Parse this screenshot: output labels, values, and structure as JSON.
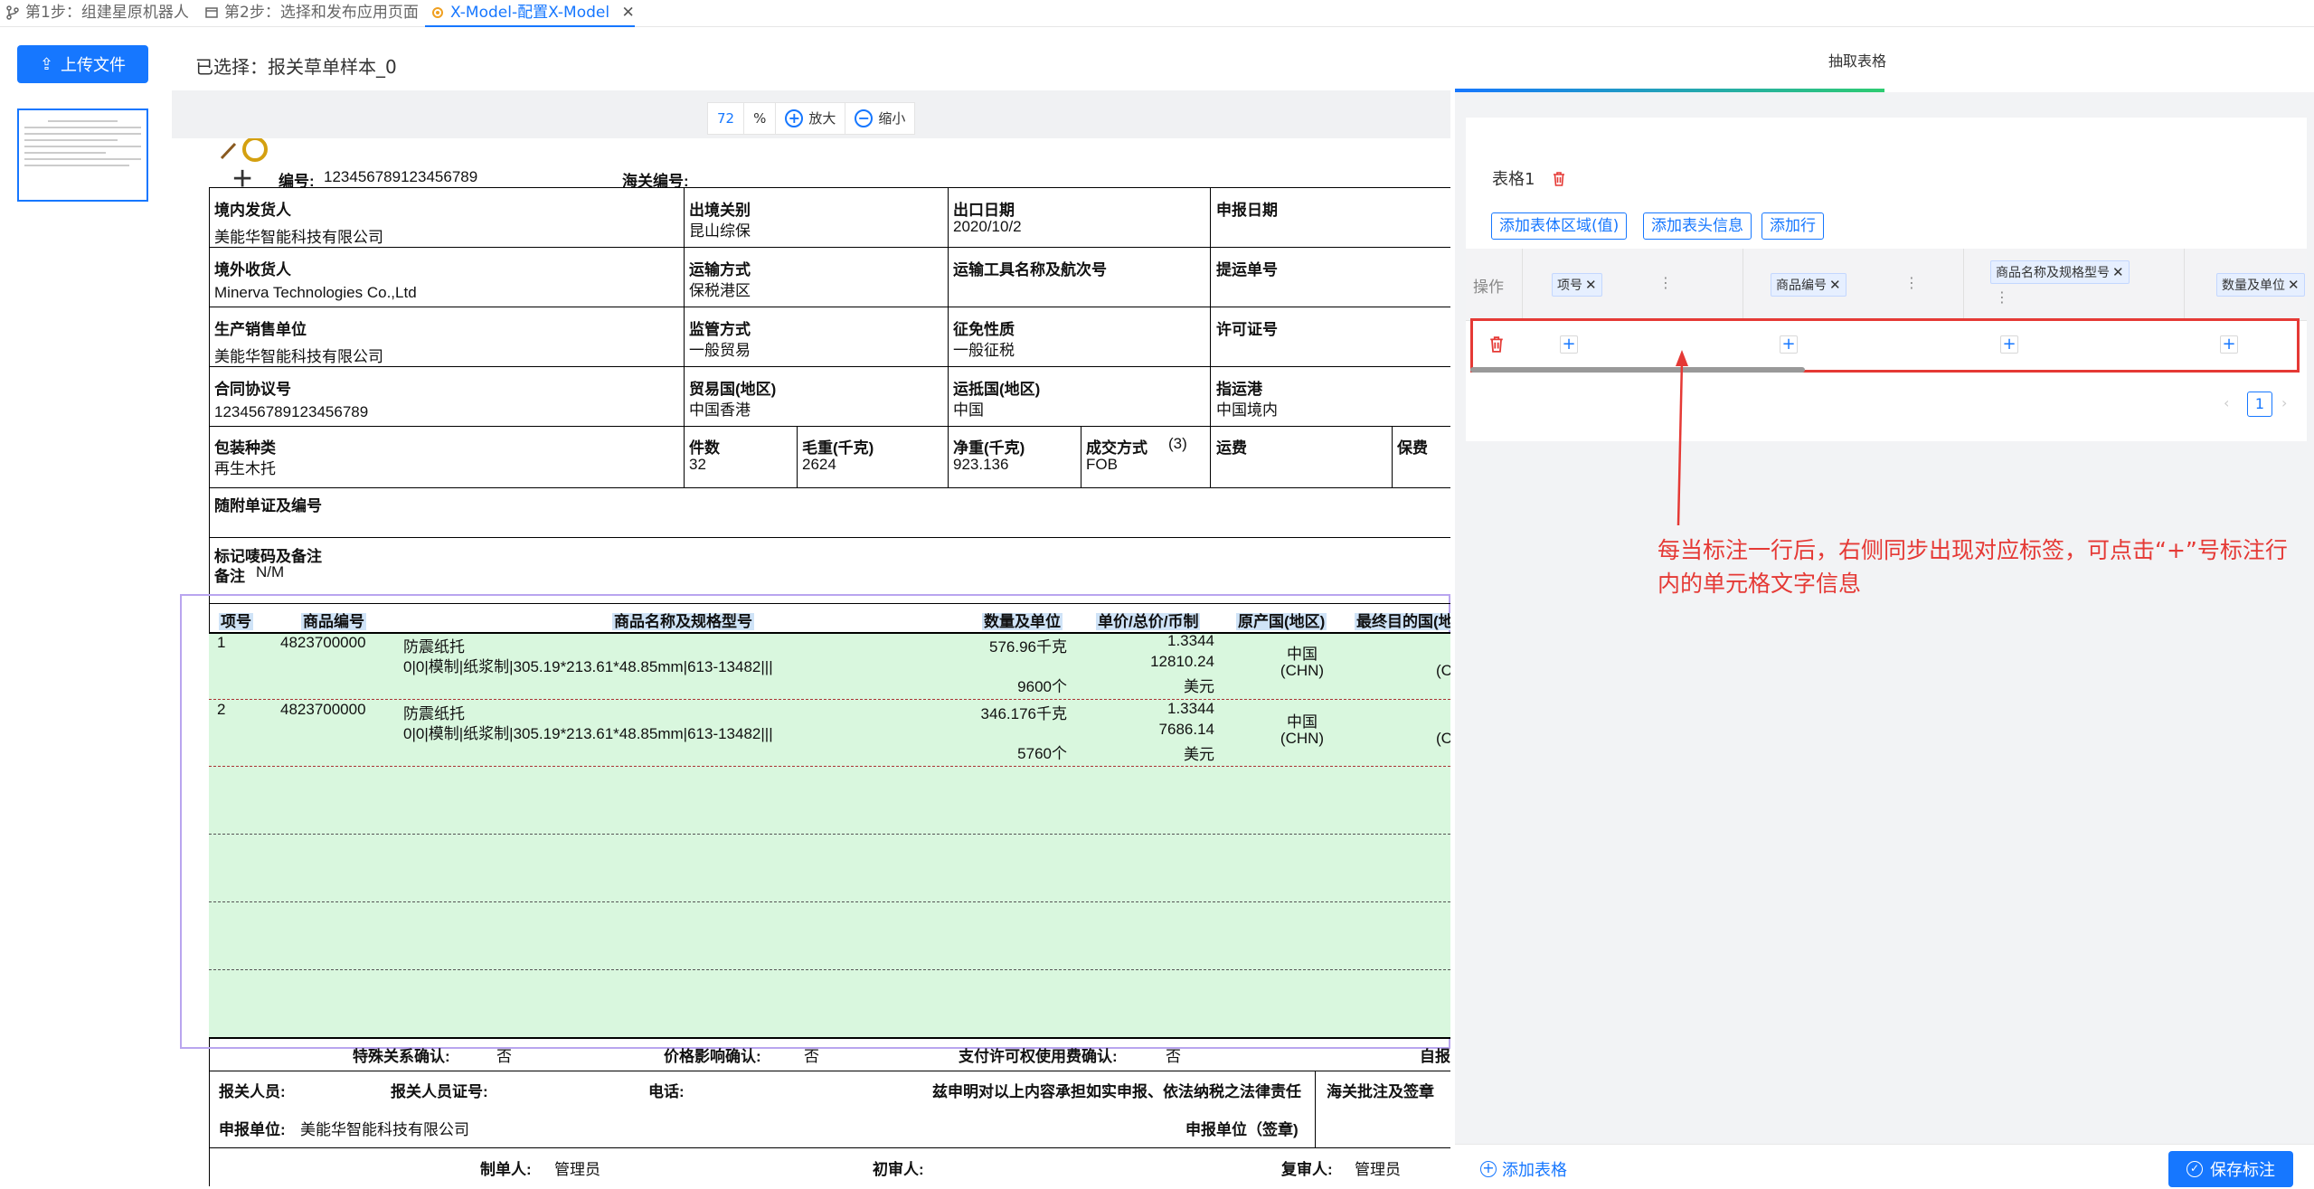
{
  "tabs": [
    {
      "label": "第1步：组建星原机器人",
      "icon": "branch-icon"
    },
    {
      "label": "第2步：选择和发布应用页面",
      "icon": "window-icon"
    },
    {
      "label": "X-Model-配置X-Model",
      "icon": "gear-icon",
      "active": true
    }
  ],
  "left": {
    "upload_label": "上传文件",
    "selected_text": "已选择：报关草单样本_0"
  },
  "zoom": {
    "value": "72",
    "unit": "%",
    "zoom_in": "放大",
    "zoom_out": "缩小"
  },
  "document": {
    "row0": {
      "no_label": "编号:",
      "no_value": "123456789123456789",
      "customs_label": "海关编号:"
    },
    "r1": {
      "c1": "境内发货人",
      "c1v": "美能华智能科技有限公司",
      "c2": "出境关别",
      "c2v": "昆山综保",
      "c3": "出口日期",
      "c3v": "2020/10/2",
      "c4": "申报日期"
    },
    "r2": {
      "c1": "境外收货人",
      "c1v": "Minerva Technologies Co.,Ltd",
      "c2": "运输方式",
      "c2v": "保税港区",
      "c3": "运输工具名称及航次号",
      "c4": "提运单号"
    },
    "r3": {
      "c1": "生产销售单位",
      "c1v": "美能华智能科技有限公司",
      "c2": "监管方式",
      "c2v": "一般贸易",
      "c3": "征免性质",
      "c3v": "一般征税",
      "c4": "许可证号"
    },
    "r4": {
      "c1": "合同协议号",
      "c1v": "123456789123456789",
      "c2": "贸易国(地区)",
      "c2v": "中国香港",
      "c3": "运抵国(地区)",
      "c3v": "中国",
      "c4": "指运港",
      "c4v": "中国境内"
    },
    "r5": {
      "c1": "包装种类",
      "c1v": "再生木托",
      "c2": "件数",
      "c2v": "32",
      "c3": "毛重(千克)",
      "c3v": "2624",
      "c4": "净重(千克)",
      "c4v": "923.136",
      "c5": "成交方式",
      "c5n": "(3)",
      "c5v": "FOB",
      "c6": "运费",
      "c7": "保费"
    },
    "r6": {
      "c1": "随附单证及编号"
    },
    "r7": {
      "c1": "标记唛码及备注",
      "remark_label": "备注",
      "remark_value": "N/M"
    },
    "goods_headers": [
      "项号",
      "商品编号",
      "商品名称及规格型号",
      "数量及单位",
      "单价/总价/币制",
      "原产国(地区)",
      "最终目的国(地"
    ],
    "goods": [
      {
        "no": "1",
        "code": "4823700000",
        "name": "防震纸托",
        "spec": "0|0|模制|纸浆制|305.19*213.61*48.85mm|613-13482|||",
        "qty1": "576.96千克",
        "qty2": "9600个",
        "price": "1.3344",
        "total": "12810.24",
        "currency": "美元",
        "origin": "中国",
        "origin_code": "(CHN)",
        "dest_partial": "(C"
      },
      {
        "no": "2",
        "code": "4823700000",
        "name": "防震纸托",
        "spec": "0|0|模制|纸浆制|305.19*213.61*48.85mm|613-13482|||",
        "qty1": "346.176千克",
        "qty2": "5760个",
        "price": "1.3344",
        "total": "7686.14",
        "currency": "美元",
        "origin": "中国",
        "origin_code": "(CHN)",
        "dest_partial": "(C"
      }
    ],
    "confirm": {
      "special": "特殊关系确认:",
      "special_v": "否",
      "price": "价格影响确认:",
      "price_v": "否",
      "royalty": "支付许可权使用费确认:",
      "royalty_v": "否",
      "self": "自报"
    },
    "footer": {
      "declarant": "报关人员:",
      "declarant_no": "报关人员证号:",
      "phone": "电话:",
      "statement": "兹申明对以上内容承担如实申报、依法纳税之法律责任",
      "customs_note": "海关批注及签章",
      "unit_label": "申报单位:",
      "unit_value": "美能华智能科技有限公司",
      "unit_sign": "申报单位（签章)"
    },
    "makers": {
      "maker": "制单人:",
      "maker_v": "管理员",
      "first": "初审人:",
      "review": "复审人:",
      "review_v": "管理员"
    }
  },
  "right": {
    "tab_title": "抽取表格",
    "table_name": "表格1",
    "buttons": [
      "添加表体区域(值)",
      "添加表头信息",
      "添加行"
    ],
    "op_header": "操作",
    "columns": [
      "项号",
      "商品编号",
      "商品名称及规格型号",
      "数量及单位"
    ],
    "page": "1",
    "add_table": "添加表格",
    "save": "保存标注"
  },
  "annotation": "每当标注一行后，右侧同步出现对应标签，可点击“+”号标注行内的单元格文字信息",
  "colors": {
    "accent": "#1677ff",
    "annotation_red": "#e53935",
    "highlight_green": "#d9f7de"
  }
}
